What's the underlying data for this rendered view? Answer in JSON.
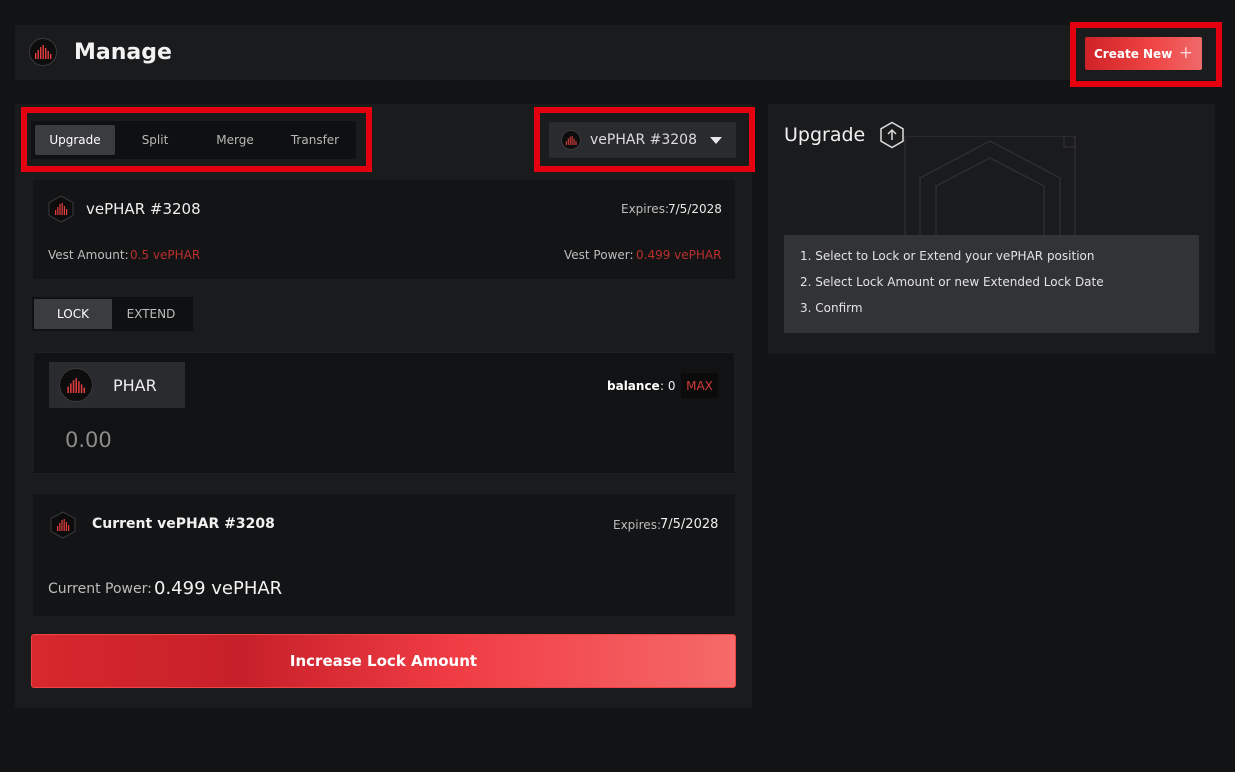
{
  "header": {
    "title": "Manage",
    "create_new_label": "Create New",
    "create_new_icon": "plus-icon"
  },
  "tabs": [
    {
      "label": "Upgrade",
      "active": true
    },
    {
      "label": "Split",
      "active": false
    },
    {
      "label": "Merge",
      "active": false
    },
    {
      "label": "Transfer",
      "active": false
    }
  ],
  "selector": {
    "selected": "vePHAR #3208"
  },
  "vest": {
    "name": "vePHAR #3208",
    "expires_label": "Expires:",
    "expires_value": "7/5/2028",
    "amount_label": "Vest Amount:",
    "amount_value": "0.5 vePHAR",
    "power_label": "Vest Power:",
    "power_value": "0.499 vePHAR"
  },
  "mode_toggle": {
    "lock": "LOCK",
    "extend": "EXTEND",
    "active": "LOCK"
  },
  "amount": {
    "token": "PHAR",
    "balance_label": "balance",
    "balance_value": ": 0",
    "max_label": "MAX",
    "value": "0.00"
  },
  "current": {
    "title": "Current vePHAR #3208",
    "expires_label": "Expires:",
    "expires_value": "7/5/2028",
    "power_label": "Current Power:",
    "power_value": "0.499 vePHAR"
  },
  "action_button": "Increase Lock Amount",
  "side_panel": {
    "title": "Upgrade",
    "icon": "upgrade-arrow-icon",
    "steps": [
      "1. Select to Lock or Extend your vePHAR position",
      "2. Select Lock Amount or new Extended Lock Date",
      "3. Confirm"
    ]
  },
  "colors": {
    "accent": "#f04646",
    "highlight": "#e4000f",
    "background": "#121315"
  }
}
